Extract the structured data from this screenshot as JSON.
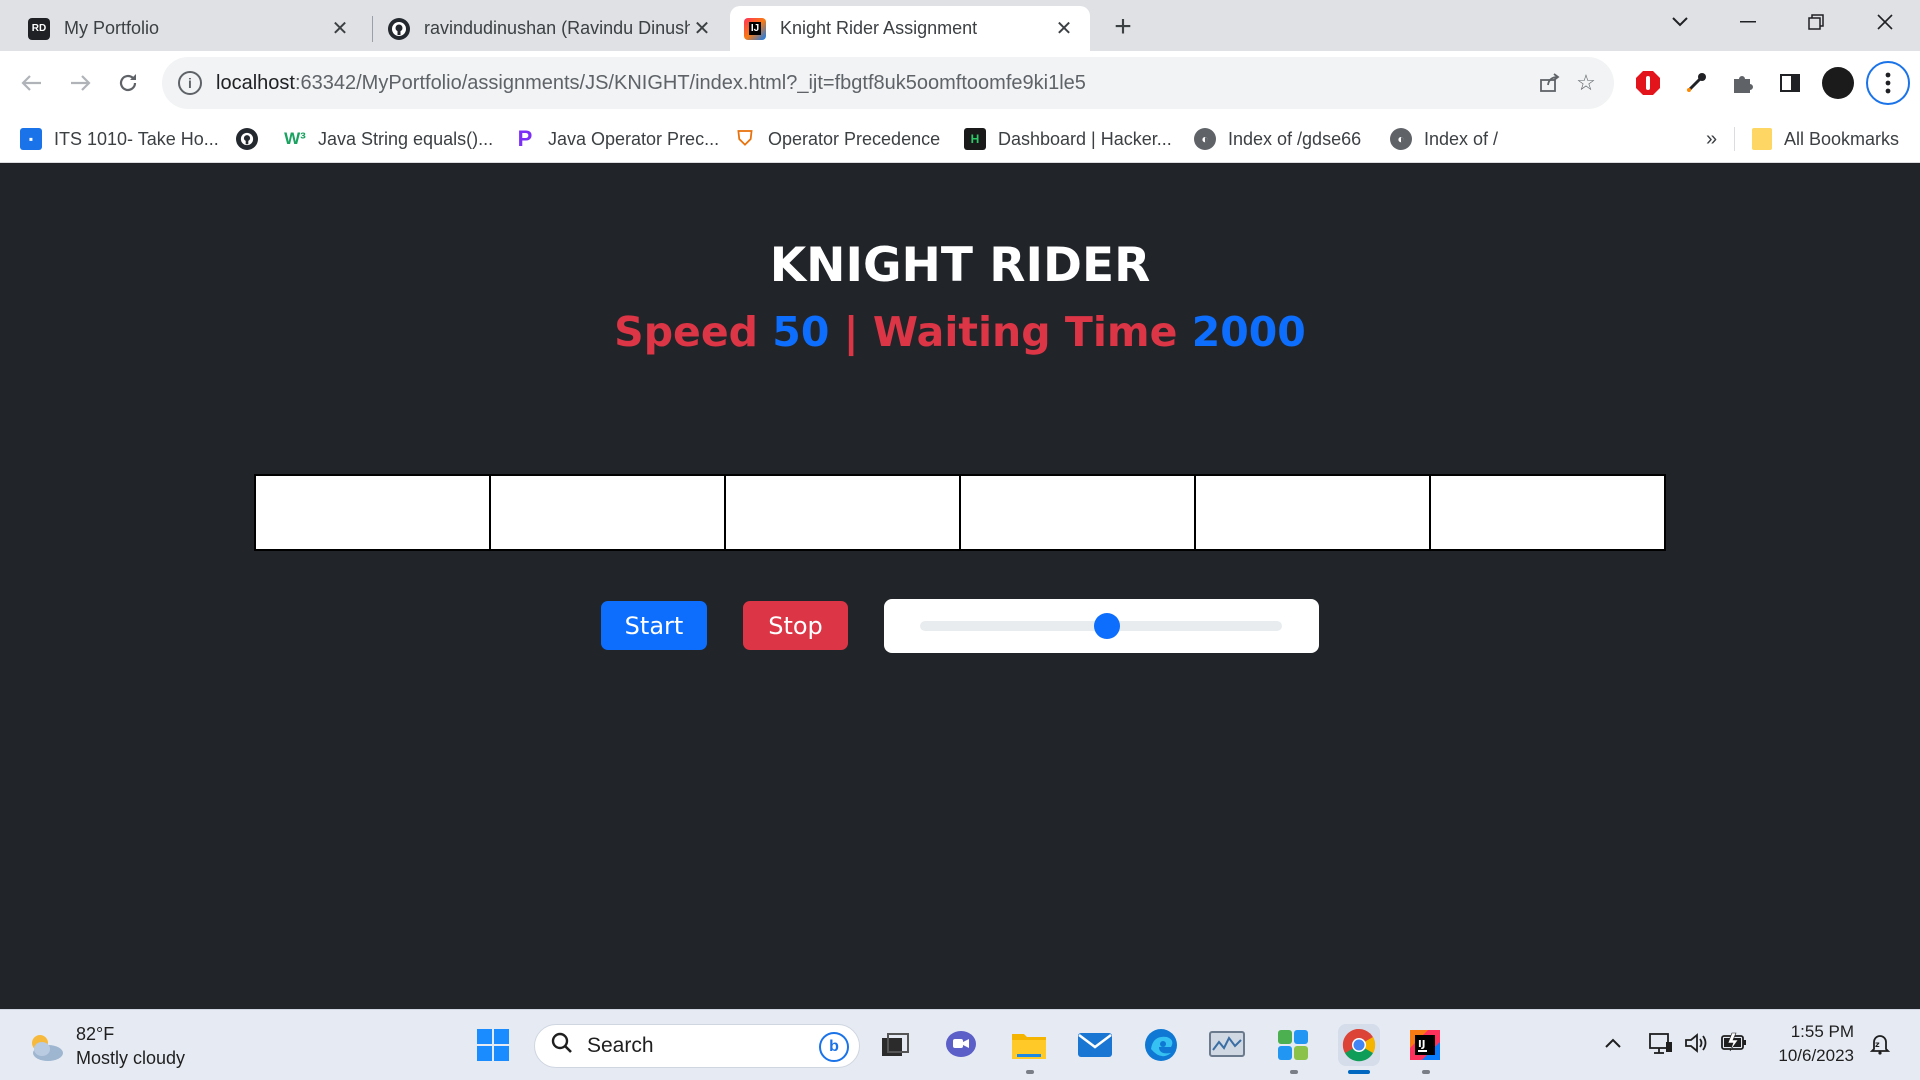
{
  "browser": {
    "tabs": [
      {
        "label": "My Portfolio",
        "favicon": "RD"
      },
      {
        "label": "ravindudinushan (Ravindu Dinushan)",
        "favicon": "github"
      },
      {
        "label": "Knight Rider Assignment",
        "favicon": "IJ"
      }
    ],
    "address": {
      "host": "localhost",
      "rest": ":63342/MyPortfolio/assignments/JS/KNIGHT/index.html?_ijt=fbgtf8uk5oomftoomfe9ki1le5"
    },
    "bookmarks": [
      {
        "label": "ITS 1010- Take Ho..."
      },
      {
        "label": "Java String equals()..."
      },
      {
        "label": "Java Operator Prec..."
      },
      {
        "label": "Operator Precedence"
      },
      {
        "label": "Dashboard | Hacker..."
      },
      {
        "label": "Index of /gdse66"
      },
      {
        "label": "Index of /"
      }
    ],
    "bookmarks_overflow": "»",
    "all_bookmarks": "All Bookmarks"
  },
  "page": {
    "title": "KNIGHT RIDER",
    "speed_label": "Speed",
    "speed_value": "50",
    "separator": "|",
    "waiting_label": "Waiting Time",
    "waiting_value": "2000",
    "lights_count": 6,
    "start_label": "Start",
    "stop_label": "Stop",
    "slider_value_fraction": 0.5
  },
  "taskbar": {
    "temperature": "82°F",
    "weather": "Mostly cloudy",
    "search_placeholder": "Search",
    "time": "1:55 PM",
    "date": "10/6/2023"
  },
  "colors": {
    "page_bg": "#212529",
    "red": "#dc3545",
    "blue": "#0d6efd"
  }
}
